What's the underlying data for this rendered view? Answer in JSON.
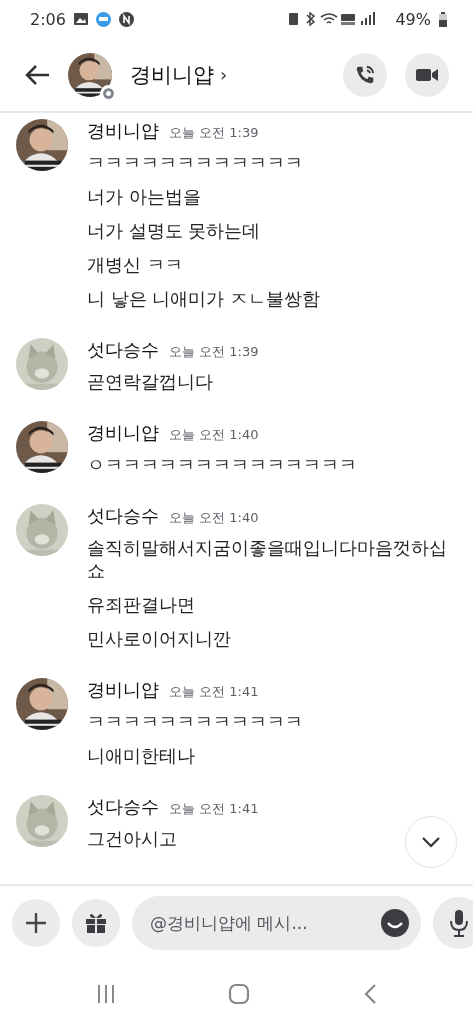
{
  "status_bar": {
    "time": "2:06",
    "battery": "49%"
  },
  "header": {
    "name": "경비니얍",
    "chevron": "›",
    "online": false
  },
  "messages": [
    {
      "author": "경비니얍",
      "time": "오늘 오전 1:39",
      "lines": [
        "ㅋㅋㅋㅋㅋㅋㅋㅋㅋㅋㅋㅋ",
        "너가 아는법을",
        "너가 설명도 못하는데",
        "개병신 ㅋㅋ",
        "니 낳은 니애미가 ㅈㄴ불쌍함"
      ]
    },
    {
      "author": "섯다승수",
      "time": "오늘 오전 1:39",
      "lines": [
        "곧연락갈껍니다"
      ]
    },
    {
      "author": "경비니얍",
      "time": "오늘 오전 1:40",
      "lines": [
        "ㅇㅋㅋㅋㅋㅋㅋㅋㅋㅋㅋㅋㅋㅋㅋ"
      ]
    },
    {
      "author": "섯다승수",
      "time": "오늘 오전 1:40",
      "lines": [
        "솔직히말해서지굼이좋을때입니다마음껏하십쇼",
        "유죄판결나면",
        "민사로이어지니깐"
      ]
    },
    {
      "author": "경비니얍",
      "time": "오늘 오전 1:41",
      "lines": [
        "ㅋㅋㅋㅋㅋㅋㅋㅋㅋㅋㅋㅋ",
        "니애미한테나"
      ]
    },
    {
      "author": "섯다승수",
      "time": "오늘 오전 1:41",
      "lines": [
        "그건아시고"
      ]
    }
  ],
  "composer": {
    "placeholder": "@경비니얍에 메시..."
  }
}
